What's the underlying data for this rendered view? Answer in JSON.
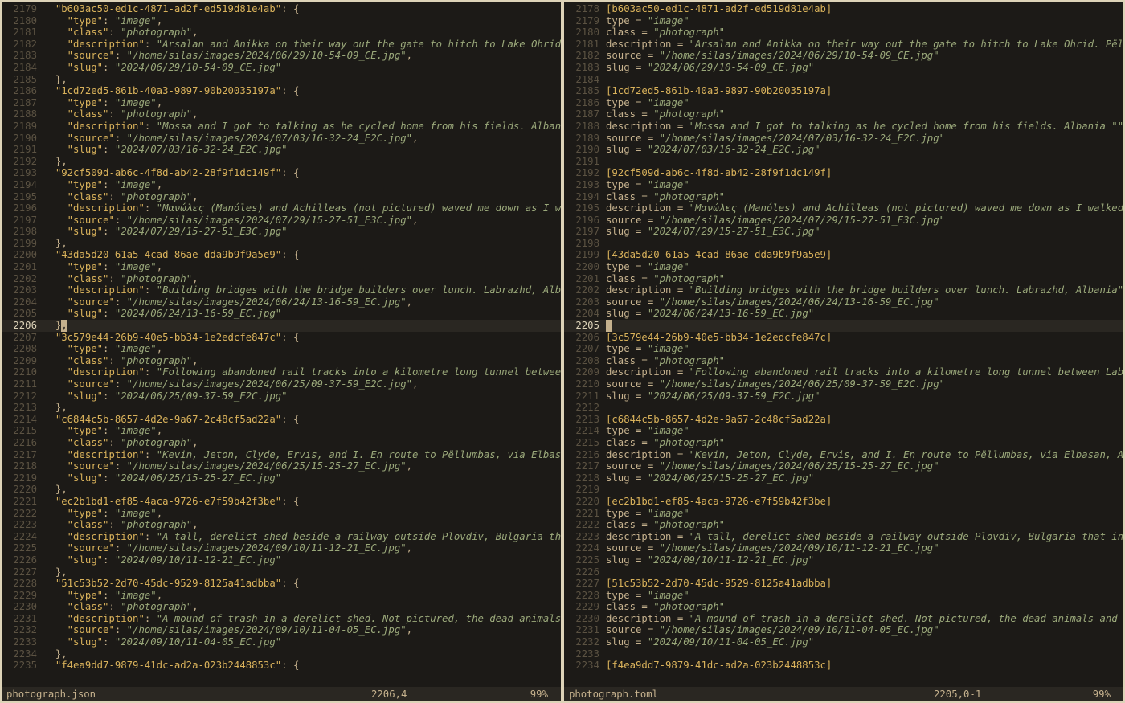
{
  "left": {
    "filename": "photograph.json",
    "cursor_pos": "2206,4",
    "percent": "99%",
    "cursor_lineno": 2206,
    "lines": [
      {
        "n": 2179,
        "t": "json_obj_open",
        "indent": "  ",
        "key": "b603ac50-ed1c-4871-ad2f-ed519d81e4ab"
      },
      {
        "n": 2180,
        "t": "json_kv",
        "indent": "    ",
        "key": "type",
        "val": "image",
        "comma": true
      },
      {
        "n": 2181,
        "t": "json_kv",
        "indent": "    ",
        "key": "class",
        "val": "photograph",
        "comma": true
      },
      {
        "n": 2182,
        "t": "json_kv",
        "indent": "    ",
        "key": "description",
        "val": "Arsalan and Anikka on their way out the gate to hitch to Lake Ohrid."
      },
      {
        "n": 2183,
        "t": "json_kv",
        "indent": "    ",
        "key": "source",
        "val": "/home/silas/images/2024/06/29/10-54-09_CE.jpg",
        "comma": true
      },
      {
        "n": 2184,
        "t": "json_kv",
        "indent": "    ",
        "key": "slug",
        "val": "2024/06/29/10-54-09_CE.jpg"
      },
      {
        "n": 2185,
        "t": "json_close",
        "indent": "  ",
        "comma": true
      },
      {
        "n": 2186,
        "t": "json_obj_open",
        "indent": "  ",
        "key": "1cd72ed5-861b-40a3-9897-90b20035197a"
      },
      {
        "n": 2187,
        "t": "json_kv",
        "indent": "    ",
        "key": "type",
        "val": "image",
        "comma": true
      },
      {
        "n": 2188,
        "t": "json_kv",
        "indent": "    ",
        "key": "class",
        "val": "photograph",
        "comma": true
      },
      {
        "n": 2189,
        "t": "json_kv",
        "indent": "    ",
        "key": "description",
        "val": "Mossa and I got to talking as he cycled home from his fields. Albania"
      },
      {
        "n": 2190,
        "t": "json_kv",
        "indent": "    ",
        "key": "source",
        "val": "/home/silas/images/2024/07/03/16-32-24_E2C.jpg",
        "comma": true
      },
      {
        "n": 2191,
        "t": "json_kv",
        "indent": "    ",
        "key": "slug",
        "val": "2024/07/03/16-32-24_E2C.jpg"
      },
      {
        "n": 2192,
        "t": "json_close",
        "indent": "  ",
        "comma": true
      },
      {
        "n": 2193,
        "t": "json_obj_open",
        "indent": "  ",
        "key": "92cf509d-ab6c-4f8d-ab42-28f9f1dc149f"
      },
      {
        "n": 2194,
        "t": "json_kv",
        "indent": "    ",
        "key": "type",
        "val": "image",
        "comma": true
      },
      {
        "n": 2195,
        "t": "json_kv",
        "indent": "    ",
        "key": "class",
        "val": "photograph",
        "comma": true
      },
      {
        "n": 2196,
        "t": "json_kv",
        "indent": "    ",
        "key": "description",
        "val": "Μανώλες (Manóles) and Achilleas (not pictured) waved me down as I wal"
      },
      {
        "n": 2197,
        "t": "json_kv",
        "indent": "    ",
        "key": "source",
        "val": "/home/silas/images/2024/07/29/15-27-51_E3C.jpg",
        "comma": true
      },
      {
        "n": 2198,
        "t": "json_kv",
        "indent": "    ",
        "key": "slug",
        "val": "2024/07/29/15-27-51_E3C.jpg"
      },
      {
        "n": 2199,
        "t": "json_close",
        "indent": "  ",
        "comma": true
      },
      {
        "n": 2200,
        "t": "json_obj_open",
        "indent": "  ",
        "key": "43da5d20-61a5-4cad-86ae-dda9b9f9a5e9"
      },
      {
        "n": 2201,
        "t": "json_kv",
        "indent": "    ",
        "key": "type",
        "val": "image",
        "comma": true
      },
      {
        "n": 2202,
        "t": "json_kv",
        "indent": "    ",
        "key": "class",
        "val": "photograph",
        "comma": true
      },
      {
        "n": 2203,
        "t": "json_kv",
        "indent": "    ",
        "key": "description",
        "val": "Building bridges with the bridge builders over lunch. Labrazhd, Alban"
      },
      {
        "n": 2204,
        "t": "json_kv",
        "indent": "    ",
        "key": "source",
        "val": "/home/silas/images/2024/06/24/13-16-59_EC.jpg",
        "comma": true
      },
      {
        "n": 2205,
        "t": "json_kv",
        "indent": "    ",
        "key": "slug",
        "val": "2024/06/24/13-16-59_EC.jpg"
      },
      {
        "n": 2206,
        "t": "cursor_close",
        "indent": "  ",
        "comma": true
      },
      {
        "n": 2207,
        "t": "json_obj_open",
        "indent": "  ",
        "key": "3c579e44-26b9-40e5-bb34-1e2edcfe847c"
      },
      {
        "n": 2208,
        "t": "json_kv",
        "indent": "    ",
        "key": "type",
        "val": "image",
        "comma": true
      },
      {
        "n": 2209,
        "t": "json_kv",
        "indent": "    ",
        "key": "class",
        "val": "photograph",
        "comma": true
      },
      {
        "n": 2210,
        "t": "json_kv",
        "indent": "    ",
        "key": "description",
        "val": "Following abandoned rail tracks into a kilometre long tunnel between "
      },
      {
        "n": 2211,
        "t": "json_kv",
        "indent": "    ",
        "key": "source",
        "val": "/home/silas/images/2024/06/25/09-37-59_E2C.jpg",
        "comma": true
      },
      {
        "n": 2212,
        "t": "json_kv",
        "indent": "    ",
        "key": "slug",
        "val": "2024/06/25/09-37-59_E2C.jpg"
      },
      {
        "n": 2213,
        "t": "json_close",
        "indent": "  ",
        "comma": true
      },
      {
        "n": 2214,
        "t": "json_obj_open",
        "indent": "  ",
        "key": "c6844c5b-8657-4d2e-9a67-2c48cf5ad22a"
      },
      {
        "n": 2215,
        "t": "json_kv",
        "indent": "    ",
        "key": "type",
        "val": "image",
        "comma": true
      },
      {
        "n": 2216,
        "t": "json_kv",
        "indent": "    ",
        "key": "class",
        "val": "photograph",
        "comma": true
      },
      {
        "n": 2217,
        "t": "json_kv",
        "indent": "    ",
        "key": "description",
        "val": "Kevin, Jeton, Clyde, Ervis, and I. En route to Pëllumbas, via Elbasan"
      },
      {
        "n": 2218,
        "t": "json_kv",
        "indent": "    ",
        "key": "source",
        "val": "/home/silas/images/2024/06/25/15-25-27_EC.jpg",
        "comma": true
      },
      {
        "n": 2219,
        "t": "json_kv",
        "indent": "    ",
        "key": "slug",
        "val": "2024/06/25/15-25-27_EC.jpg"
      },
      {
        "n": 2220,
        "t": "json_close",
        "indent": "  ",
        "comma": true
      },
      {
        "n": 2221,
        "t": "json_obj_open",
        "indent": "  ",
        "key": "ec2b1bd1-ef85-4aca-9726-e7f59b42f3be"
      },
      {
        "n": 2222,
        "t": "json_kv",
        "indent": "    ",
        "key": "type",
        "val": "image",
        "comma": true
      },
      {
        "n": 2223,
        "t": "json_kv",
        "indent": "    ",
        "key": "class",
        "val": "photograph",
        "comma": true
      },
      {
        "n": 2224,
        "t": "json_kv",
        "indent": "    ",
        "key": "description",
        "val": "A tall, derelict shed beside a railway outside Plovdiv, Bulgaria that"
      },
      {
        "n": 2225,
        "t": "json_kv",
        "indent": "    ",
        "key": "source",
        "val": "/home/silas/images/2024/09/10/11-12-21_EC.jpg",
        "comma": true
      },
      {
        "n": 2226,
        "t": "json_kv",
        "indent": "    ",
        "key": "slug",
        "val": "2024/09/10/11-12-21_EC.jpg"
      },
      {
        "n": 2227,
        "t": "json_close",
        "indent": "  ",
        "comma": true
      },
      {
        "n": 2228,
        "t": "json_obj_open",
        "indent": "  ",
        "key": "51c53b52-2d70-45dc-9529-8125a41adbba"
      },
      {
        "n": 2229,
        "t": "json_kv",
        "indent": "    ",
        "key": "type",
        "val": "image",
        "comma": true
      },
      {
        "n": 2230,
        "t": "json_kv",
        "indent": "    ",
        "key": "class",
        "val": "photograph",
        "comma": true
      },
      {
        "n": 2231,
        "t": "json_kv",
        "indent": "    ",
        "key": "description",
        "val": "A mound of trash in a derelict shed. Not pictured, the dead animals a"
      },
      {
        "n": 2232,
        "t": "json_kv",
        "indent": "    ",
        "key": "source",
        "val": "/home/silas/images/2024/09/10/11-04-05_EC.jpg",
        "comma": true
      },
      {
        "n": 2233,
        "t": "json_kv",
        "indent": "    ",
        "key": "slug",
        "val": "2024/09/10/11-04-05_EC.jpg"
      },
      {
        "n": 2234,
        "t": "json_close",
        "indent": "  ",
        "comma": true
      },
      {
        "n": 2235,
        "t": "json_obj_open",
        "indent": "  ",
        "key": "f4ea9dd7-9879-41dc-ad2a-023b2448853c"
      }
    ]
  },
  "right": {
    "filename": "photograph.toml",
    "cursor_pos": "2205,0-1",
    "percent": "99%",
    "cursor_lineno": 2205,
    "lines": [
      {
        "n": 2178,
        "t": "toml_hdr",
        "val": "b603ac50-ed1c-4871-ad2f-ed519d81e4ab"
      },
      {
        "n": 2179,
        "t": "toml_kv",
        "key": "type",
        "val": "image"
      },
      {
        "n": 2180,
        "t": "toml_kv",
        "key": "class",
        "val": "photograph"
      },
      {
        "n": 2181,
        "t": "toml_kv",
        "key": "description",
        "val": "Arsalan and Anikka on their way out the gate to hitch to Lake Ohrid. Pëllu"
      },
      {
        "n": 2182,
        "t": "toml_kv",
        "key": "source",
        "val": "/home/silas/images/2024/06/29/10-54-09_CE.jpg"
      },
      {
        "n": 2183,
        "t": "toml_kv",
        "key": "slug",
        "val": "2024/06/29/10-54-09_CE.jpg"
      },
      {
        "n": 2184,
        "t": "blank"
      },
      {
        "n": 2185,
        "t": "toml_hdr",
        "val": "1cd72ed5-861b-40a3-9897-90b20035197a"
      },
      {
        "n": 2186,
        "t": "toml_kv",
        "key": "type",
        "val": "image"
      },
      {
        "n": 2187,
        "t": "toml_kv",
        "key": "class",
        "val": "photograph"
      },
      {
        "n": 2188,
        "t": "toml_kv",
        "key": "description",
        "val": "Mossa and I got to talking as he cycled home from his fields. Albania \""
      },
      {
        "n": 2189,
        "t": "toml_kv",
        "key": "source",
        "val": "/home/silas/images/2024/07/03/16-32-24_E2C.jpg"
      },
      {
        "n": 2190,
        "t": "toml_kv",
        "key": "slug",
        "val": "2024/07/03/16-32-24_E2C.jpg"
      },
      {
        "n": 2191,
        "t": "blank"
      },
      {
        "n": 2192,
        "t": "toml_hdr",
        "val": "92cf509d-ab6c-4f8d-ab42-28f9f1dc149f"
      },
      {
        "n": 2193,
        "t": "toml_kv",
        "key": "type",
        "val": "image"
      },
      {
        "n": 2194,
        "t": "toml_kv",
        "key": "class",
        "val": "photograph"
      },
      {
        "n": 2195,
        "t": "toml_kv",
        "key": "description",
        "val": "Μανώλες (Manóles) and Achilleas (not pictured) waved me down as I walked t"
      },
      {
        "n": 2196,
        "t": "toml_kv",
        "key": "source",
        "val": "/home/silas/images/2024/07/29/15-27-51_E3C.jpg"
      },
      {
        "n": 2197,
        "t": "toml_kv",
        "key": "slug",
        "val": "2024/07/29/15-27-51_E3C.jpg"
      },
      {
        "n": 2198,
        "t": "blank"
      },
      {
        "n": 2199,
        "t": "toml_hdr",
        "val": "43da5d20-61a5-4cad-86ae-dda9b9f9a5e9"
      },
      {
        "n": 2200,
        "t": "toml_kv",
        "key": "type",
        "val": "image"
      },
      {
        "n": 2201,
        "t": "toml_kv",
        "key": "class",
        "val": "photograph"
      },
      {
        "n": 2202,
        "t": "toml_kv",
        "key": "description",
        "val": "Building bridges with the bridge builders over lunch. Labrazhd, Albania\""
      },
      {
        "n": 2203,
        "t": "toml_kv",
        "key": "source",
        "val": "/home/silas/images/2024/06/24/13-16-59_EC.jpg"
      },
      {
        "n": 2204,
        "t": "toml_kv",
        "key": "slug",
        "val": "2024/06/24/13-16-59_EC.jpg"
      },
      {
        "n": 2205,
        "t": "cursor_blank"
      },
      {
        "n": 2206,
        "t": "toml_hdr",
        "val": "3c579e44-26b9-40e5-bb34-1e2edcfe847c"
      },
      {
        "n": 2207,
        "t": "toml_kv",
        "key": "type",
        "val": "image"
      },
      {
        "n": 2208,
        "t": "toml_kv",
        "key": "class",
        "val": "photograph"
      },
      {
        "n": 2209,
        "t": "toml_kv",
        "key": "description",
        "val": "Following abandoned rail tracks into a kilometre long tunnel between Labra"
      },
      {
        "n": 2210,
        "t": "toml_kv",
        "key": "source",
        "val": "/home/silas/images/2024/06/25/09-37-59_E2C.jpg"
      },
      {
        "n": 2211,
        "t": "toml_kv",
        "key": "slug",
        "val": "2024/06/25/09-37-59_E2C.jpg"
      },
      {
        "n": 2212,
        "t": "blank"
      },
      {
        "n": 2213,
        "t": "toml_hdr",
        "val": "c6844c5b-8657-4d2e-9a67-2c48cf5ad22a"
      },
      {
        "n": 2214,
        "t": "toml_kv",
        "key": "type",
        "val": "image"
      },
      {
        "n": 2215,
        "t": "toml_kv",
        "key": "class",
        "val": "photograph"
      },
      {
        "n": 2216,
        "t": "toml_kv",
        "key": "description",
        "val": "Kevin, Jeton, Clyde, Ervis, and I. En route to Pëllumbas, via Elbasan, Alb"
      },
      {
        "n": 2217,
        "t": "toml_kv",
        "key": "source",
        "val": "/home/silas/images/2024/06/25/15-25-27_EC.jpg"
      },
      {
        "n": 2218,
        "t": "toml_kv",
        "key": "slug",
        "val": "2024/06/25/15-25-27_EC.jpg"
      },
      {
        "n": 2219,
        "t": "blank"
      },
      {
        "n": 2220,
        "t": "toml_hdr",
        "val": "ec2b1bd1-ef85-4aca-9726-e7f59b42f3be"
      },
      {
        "n": 2221,
        "t": "toml_kv",
        "key": "type",
        "val": "image"
      },
      {
        "n": 2222,
        "t": "toml_kv",
        "key": "class",
        "val": "photograph"
      },
      {
        "n": 2223,
        "t": "toml_kv",
        "key": "description",
        "val": "A tall, derelict shed beside a railway outside Plovdiv, Bulgaria that insp"
      },
      {
        "n": 2224,
        "t": "toml_kv",
        "key": "source",
        "val": "/home/silas/images/2024/09/10/11-12-21_EC.jpg"
      },
      {
        "n": 2225,
        "t": "toml_kv",
        "key": "slug",
        "val": "2024/09/10/11-12-21_EC.jpg"
      },
      {
        "n": 2226,
        "t": "blank"
      },
      {
        "n": 2227,
        "t": "toml_hdr",
        "val": "51c53b52-2d70-45dc-9529-8125a41adbba"
      },
      {
        "n": 2228,
        "t": "toml_kv",
        "key": "type",
        "val": "image"
      },
      {
        "n": 2229,
        "t": "toml_kv",
        "key": "class",
        "val": "photograph"
      },
      {
        "n": 2230,
        "t": "toml_kv",
        "key": "description",
        "val": "A mound of trash in a derelict shed. Not pictured, the dead animals and fe"
      },
      {
        "n": 2231,
        "t": "toml_kv",
        "key": "source",
        "val": "/home/silas/images/2024/09/10/11-04-05_EC.jpg"
      },
      {
        "n": 2232,
        "t": "toml_kv",
        "key": "slug",
        "val": "2024/09/10/11-04-05_EC.jpg"
      },
      {
        "n": 2233,
        "t": "blank"
      },
      {
        "n": 2234,
        "t": "toml_hdr",
        "val": "f4ea9dd7-9879-41dc-ad2a-023b2448853c"
      }
    ]
  }
}
